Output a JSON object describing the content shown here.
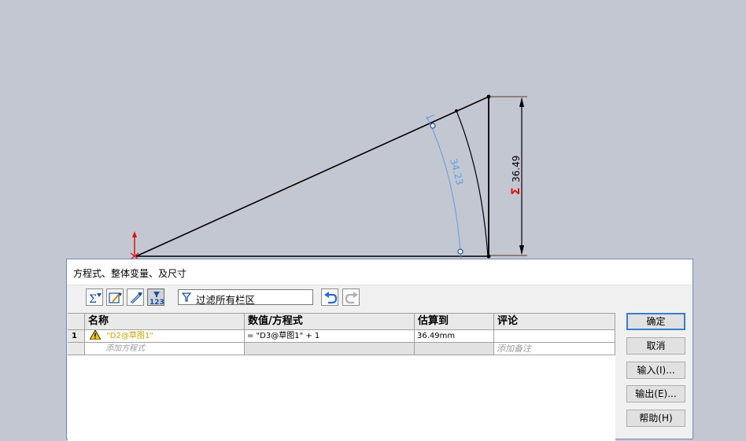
{
  "sketch": {
    "dim_height": "36.49",
    "dim_arc": "34.23",
    "equation_mark": "Σ"
  },
  "dialog": {
    "title": "方程式、整体变量、及尺寸",
    "filter_text": "过滤所有栏区",
    "toolbar_icons": [
      "equation-view-icon",
      "sketch-equation-view-icon",
      "dimension-view-icon",
      "ordered-view-icon",
      "undo-icon",
      "redo-icon"
    ],
    "columns": [
      "名称",
      "数值/方程式",
      "估算到",
      "评论"
    ],
    "rows": [
      {
        "num": "1",
        "name": "\"D2@草图1\"",
        "value": "= \"D3@草图1\" + 1",
        "eval": "36.49mm",
        "comment": ""
      }
    ],
    "add_row": {
      "name": "添加方程式",
      "comment": "添加备注"
    },
    "buttons": {
      "ok": "确定",
      "cancel": "取消",
      "import": "输入(I)...",
      "export": "输出(E)...",
      "help": "帮助(H)"
    }
  }
}
